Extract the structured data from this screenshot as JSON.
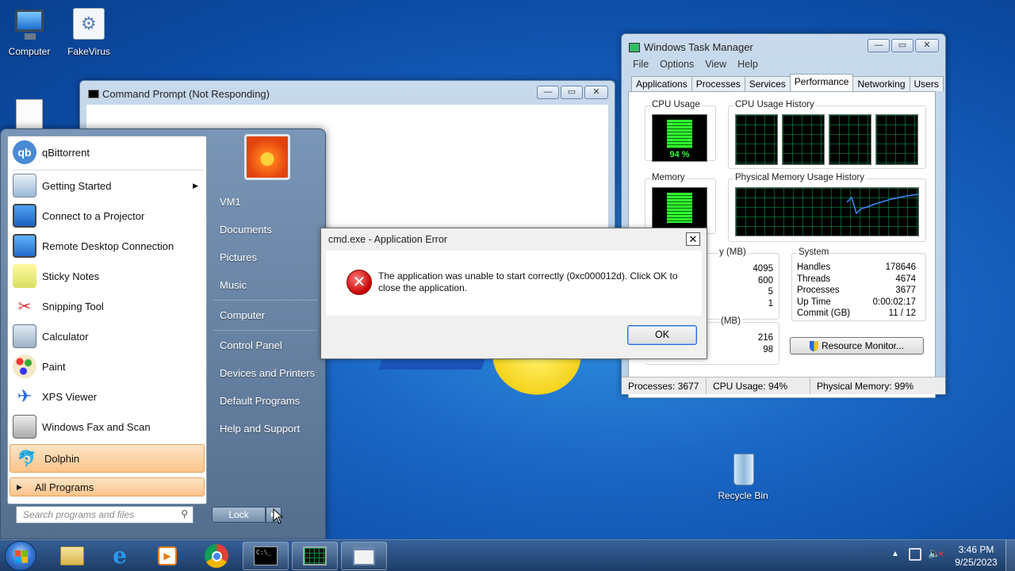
{
  "desktop": {
    "icons": [
      {
        "label": "Computer"
      },
      {
        "label": "FakeVirus"
      },
      {
        "label": "Recycle Bin"
      }
    ]
  },
  "cmd_window": {
    "title": "Command Prompt (Not Responding)"
  },
  "task_manager": {
    "title": "Windows Task Manager",
    "menu": [
      "File",
      "Options",
      "View",
      "Help"
    ],
    "tabs": [
      "Applications",
      "Processes",
      "Services",
      "Performance",
      "Networking",
      "Users"
    ],
    "active_tab": "Performance",
    "cpu_usage_label": "CPU Usage",
    "cpu_usage_value": "94 %",
    "cpu_history_label": "CPU Usage History",
    "memory_label": "Memory",
    "physical_memory_history_label": "Physical Memory Usage History",
    "phys_mem_partial_label": "y (MB)",
    "phys_mem_values": [
      "4095",
      "600",
      "5",
      "1"
    ],
    "kernel_partial_label": "(MB)",
    "kernel_values": [
      "216",
      "98"
    ],
    "system_label": "System",
    "system": [
      {
        "label": "Handles",
        "value": "178646"
      },
      {
        "label": "Threads",
        "value": "4674"
      },
      {
        "label": "Processes",
        "value": "3677"
      },
      {
        "label": "Up Time",
        "value": "0:00:02:17"
      },
      {
        "label": "Commit (GB)",
        "value": "11 / 12"
      }
    ],
    "resource_monitor_label": "Resource Monitor...",
    "status": {
      "processes": "Processes: 3677",
      "cpu": "CPU Usage: 94%",
      "memory": "Physical Memory: 99%"
    }
  },
  "start_menu": {
    "programs": [
      {
        "label": "qBittorrent",
        "icon": "qbittorrent-icon"
      },
      {
        "label": "Getting Started",
        "icon": "getting-started-icon"
      },
      {
        "label": "Connect to a Projector",
        "icon": "projector-icon"
      },
      {
        "label": "Remote Desktop Connection",
        "icon": "remote-desktop-icon"
      },
      {
        "label": "Sticky Notes",
        "icon": "sticky-notes-icon"
      },
      {
        "label": "Snipping Tool",
        "icon": "snipping-tool-icon"
      },
      {
        "label": "Calculator",
        "icon": "calculator-icon"
      },
      {
        "label": "Paint",
        "icon": "paint-icon"
      },
      {
        "label": "XPS Viewer",
        "icon": "xps-viewer-icon"
      },
      {
        "label": "Windows Fax and Scan",
        "icon": "fax-scan-icon"
      },
      {
        "label": "Dolphin",
        "icon": "dolphin-icon"
      }
    ],
    "all_programs": "All Programs",
    "search_placeholder": "Search programs and files",
    "right_items": [
      "VM1",
      "Documents",
      "Pictures",
      "Music",
      "Computer",
      "Control Panel",
      "Devices and Printers",
      "Default Programs",
      "Help and Support"
    ],
    "lock_label": "Lock"
  },
  "error_dialog": {
    "title": "cmd.exe - Application Error",
    "message": "The application was unable to start correctly (0xc000012d). Click OK to close the application.",
    "ok_label": "OK"
  },
  "taskbar": {
    "time": "3:46 PM",
    "date": "9/25/2023"
  }
}
